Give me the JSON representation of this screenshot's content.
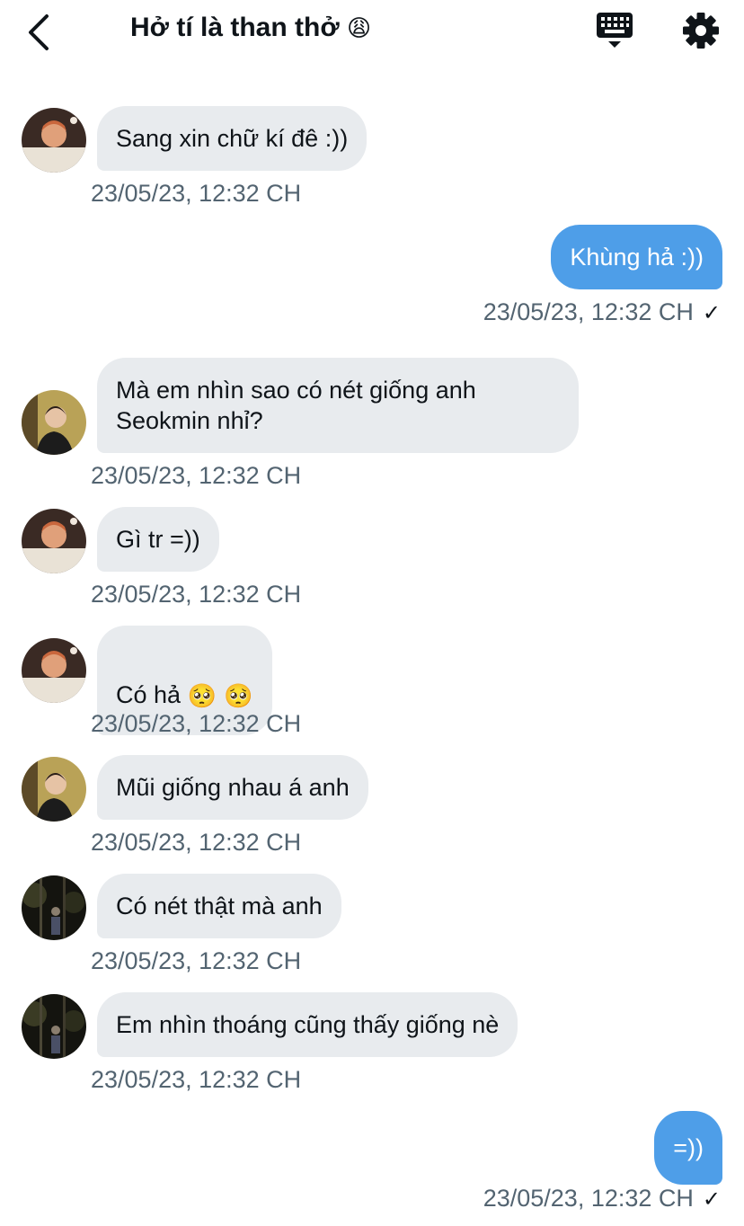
{
  "header": {
    "title": "Hở tí là than thở",
    "title_emoji": "😩",
    "back_icon": "chevron-left-icon",
    "keyboard_icon": "keyboard-icon",
    "settings_icon": "gear-icon"
  },
  "colors": {
    "incoming_bubble": "#e8ebee",
    "outgoing_bubble": "#4e9ee8",
    "timestamp": "#536471"
  },
  "messages": [
    {
      "direction": "in",
      "avatar": "avatar-a",
      "text": "Sang xin chữ kí đê :))",
      "time": "23/05/23, 12:32 CH"
    },
    {
      "direction": "out",
      "text": "Khùng hả :))",
      "time": "23/05/23, 12:32 CH",
      "read_mark": "✓"
    },
    {
      "direction": "in",
      "avatar": "avatar-b",
      "text": "Mà em nhìn sao có nét giống anh\nSeokmin nhỉ?",
      "time": "23/05/23, 12:32 CH"
    },
    {
      "direction": "in",
      "avatar": "avatar-a",
      "text": "Gì tr =))",
      "time": "23/05/23, 12:32 CH"
    },
    {
      "direction": "in",
      "avatar": "avatar-a",
      "text": "Có hả",
      "emoji": "🥺 🥺",
      "time": "23/05/23, 12:32 CH"
    },
    {
      "direction": "in",
      "avatar": "avatar-b",
      "text": "Mũi giống nhau á anh",
      "time": "23/05/23, 12:32 CH"
    },
    {
      "direction": "in",
      "avatar": "avatar-c",
      "text": "Có nét thật mà anh",
      "time": "23/05/23, 12:32 CH"
    },
    {
      "direction": "in",
      "avatar": "avatar-c",
      "text": "Em nhìn thoáng cũng thấy giống nè",
      "time": "23/05/23, 12:32 CH"
    },
    {
      "direction": "out",
      "text": "=))",
      "time": "23/05/23, 12:32 CH",
      "read_mark": "✓"
    }
  ]
}
